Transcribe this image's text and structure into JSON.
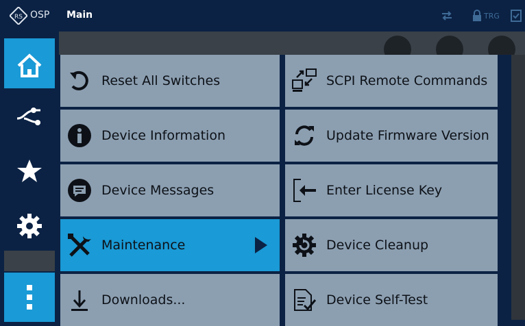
{
  "app": {
    "name": "OSP",
    "title": "Main",
    "trigger_label": "TRG"
  },
  "nav": {
    "items": [
      {
        "id": "home",
        "icon": "home-icon",
        "active": true
      },
      {
        "id": "paths",
        "icon": "path-icon",
        "active": false
      },
      {
        "id": "favorites",
        "icon": "star-icon",
        "active": false
      },
      {
        "id": "setup",
        "icon": "gear-icon",
        "active": false
      },
      {
        "id": "more",
        "icon": "more-vertical-icon",
        "active": true
      }
    ]
  },
  "menu": {
    "left": [
      {
        "label": "Reset All Switches",
        "icon": "reset-icon"
      },
      {
        "label": "Device Information",
        "icon": "info-icon"
      },
      {
        "label": "Device Messages",
        "icon": "message-icon"
      },
      {
        "label": "Maintenance",
        "icon": "tools-icon",
        "active": true,
        "has_submenu": true
      },
      {
        "label": "Downloads...",
        "icon": "download-icon"
      }
    ],
    "right": [
      {
        "label": "SCPI Remote Commands",
        "icon": "scpi-icon"
      },
      {
        "label": "Update Firmware Version",
        "icon": "refresh-icon"
      },
      {
        "label": "Enter License Key",
        "icon": "license-key-icon"
      },
      {
        "label": "Device Cleanup",
        "icon": "cleanup-icon"
      },
      {
        "label": "Device Self-Test",
        "icon": "self-test-icon"
      }
    ]
  },
  "colors": {
    "accent": "#1a9ad6",
    "cell": "#8c9fb1",
    "frame": "#0b2244"
  }
}
